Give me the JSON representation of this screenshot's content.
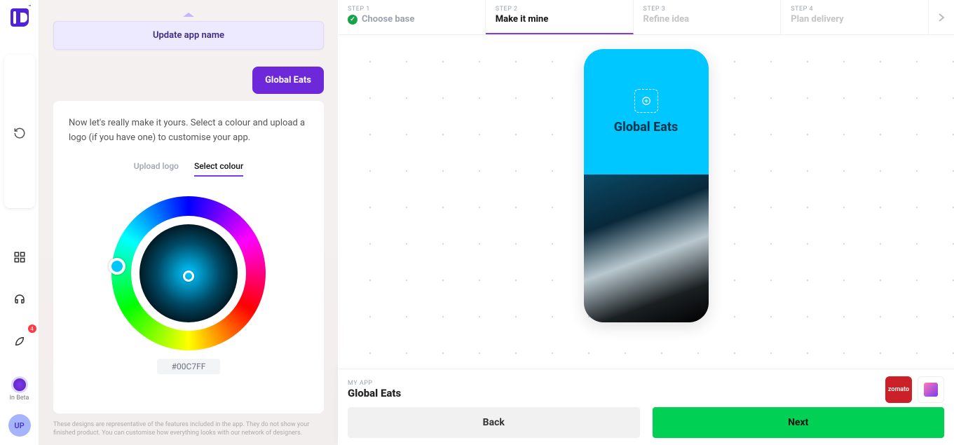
{
  "brand_tm": "™",
  "nav": {
    "beta_label": "In Beta",
    "avatar_initials": "UP",
    "rocket_badge": "4"
  },
  "config": {
    "update_button": "Update app name",
    "reply_chip": "Global Eats",
    "card_intro": "Now let's really make it yours. Select a colour and upload a logo (if you have one) to customise your app.",
    "tab_upload": "Upload logo",
    "tab_colour": "Select colour",
    "hex_value": "#00C7FF",
    "disclaimer": "These designs are representative of the features included in the app. They do not show your finished product. You can customise how everything looks with our network of designers."
  },
  "steps": [
    {
      "num": "STEP 1",
      "title": "Choose base",
      "state": "done"
    },
    {
      "num": "STEP 2",
      "title": "Make it mine",
      "state": "active"
    },
    {
      "num": "STEP 3",
      "title": "Refine idea",
      "state": "future"
    },
    {
      "num": "STEP 4",
      "title": "Plan delivery",
      "state": "future"
    }
  ],
  "phone": {
    "app_name": "Global Eats"
  },
  "footer": {
    "label": "MY APP",
    "app_name": "Global Eats",
    "brand_chip_1": "zomato",
    "back": "Back",
    "next": "Next"
  }
}
